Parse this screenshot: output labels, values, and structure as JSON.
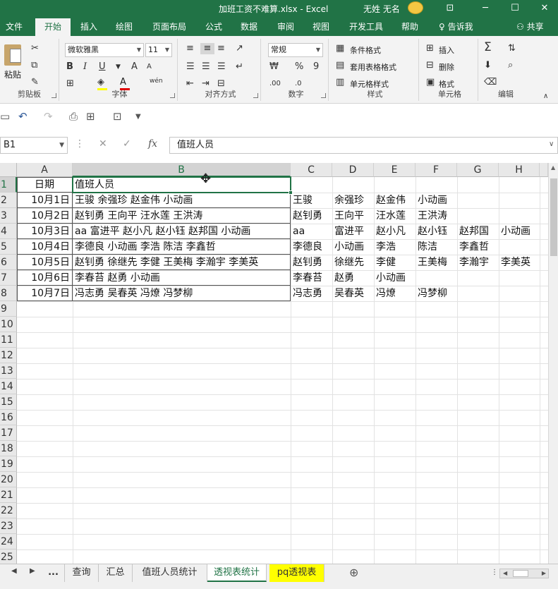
{
  "title_bar": {
    "document": "加班工资不难算.xlsx  -  Excel",
    "user": "无姓 无名",
    "controls": [
      "⊡",
      "─",
      "☐",
      "✕"
    ]
  },
  "ribbon_tabs": [
    "文件",
    "开始",
    "插入",
    "绘图",
    "页面布局",
    "公式",
    "数据",
    "审阅",
    "视图",
    "开发工具",
    "帮助"
  ],
  "ribbon_active_tab": "开始",
  "tell_me": "告诉我",
  "share": "共享",
  "ribbon": {
    "clipboard": {
      "label": "剪贴板",
      "paste": "粘贴"
    },
    "font": {
      "label": "字体",
      "name": "微软雅黑",
      "size": "11",
      "bold": "B",
      "italic": "I",
      "underline": "U",
      "wen": "wén"
    },
    "alignment": {
      "label": "对齐方式"
    },
    "number": {
      "label": "数字",
      "format": "常规",
      "percent": "%",
      "comma": "9"
    },
    "styles": {
      "label": "样式",
      "conditional": "条件格式",
      "table": "套用表格格式",
      "cell": "单元格样式"
    },
    "cells": {
      "label": "单元格",
      "insert": "插入",
      "delete": "删除",
      "format": "格式"
    },
    "editing": {
      "label": "编辑"
    }
  },
  "name_box": "B1",
  "formula_bar": {
    "value": "值班人员",
    "fx": "fx"
  },
  "columns": [
    "A",
    "B",
    "C",
    "D",
    "E",
    "F",
    "G",
    "H"
  ],
  "rows": [
    "1",
    "2",
    "3",
    "4",
    "5",
    "6",
    "7",
    "8",
    "9",
    "10",
    "11",
    "12",
    "13",
    "14",
    "15",
    "16",
    "17",
    "18",
    "19",
    "20",
    "21",
    "22",
    "23",
    "24",
    "25"
  ],
  "table": {
    "header": {
      "date": "日期",
      "staff": "值班人员"
    },
    "records": [
      {
        "date": "10月1日",
        "staff": "王骏 余强珍 赵金伟 小动画",
        "split": [
          "王骏",
          "余强珍",
          "赵金伟",
          "小动画",
          "",
          ""
        ]
      },
      {
        "date": "10月2日",
        "staff": "赵钊勇 王向平 汪水莲 王洪涛",
        "split": [
          "赵钊勇",
          "王向平",
          "汪水莲",
          "王洪涛",
          "",
          ""
        ]
      },
      {
        "date": "10月3日",
        "staff": "aa 富进平 赵小凡 赵小钰 赵邦国 小动画",
        "split": [
          "aa",
          "富进平",
          "赵小凡",
          "赵小钰",
          "赵邦国",
          "小动画"
        ]
      },
      {
        "date": "10月4日",
        "staff": "李德良 小动画 李浩 陈洁 李鑫哲",
        "split": [
          "李德良",
          "小动画",
          "李浩",
          "陈洁",
          "李鑫哲",
          ""
        ]
      },
      {
        "date": "10月5日",
        "staff": "赵钊勇 徐继先 李健 王美梅 李瀚宇 李美英",
        "split": [
          "赵钊勇",
          "徐继先",
          "李健",
          "王美梅",
          "李瀚宇",
          "李美英"
        ]
      },
      {
        "date": "10月6日",
        "staff": "李春苔 赵勇 小动画",
        "split": [
          "李春苔",
          "赵勇",
          "小动画",
          "",
          "",
          ""
        ]
      },
      {
        "date": "10月7日",
        "staff": "冯志勇 吴春英 冯燎 冯梦柳",
        "split": [
          "冯志勇",
          "吴春英",
          "冯燎",
          "冯梦柳",
          "",
          ""
        ]
      }
    ]
  },
  "sheet_tabs": [
    "...",
    "查询",
    "汇总",
    "值班人员统计",
    "透视表统计",
    "pq透视表"
  ],
  "active_sheet": "透视表统计",
  "colors": {
    "accent": "#217346",
    "highlight_tab": "#ffff00"
  }
}
